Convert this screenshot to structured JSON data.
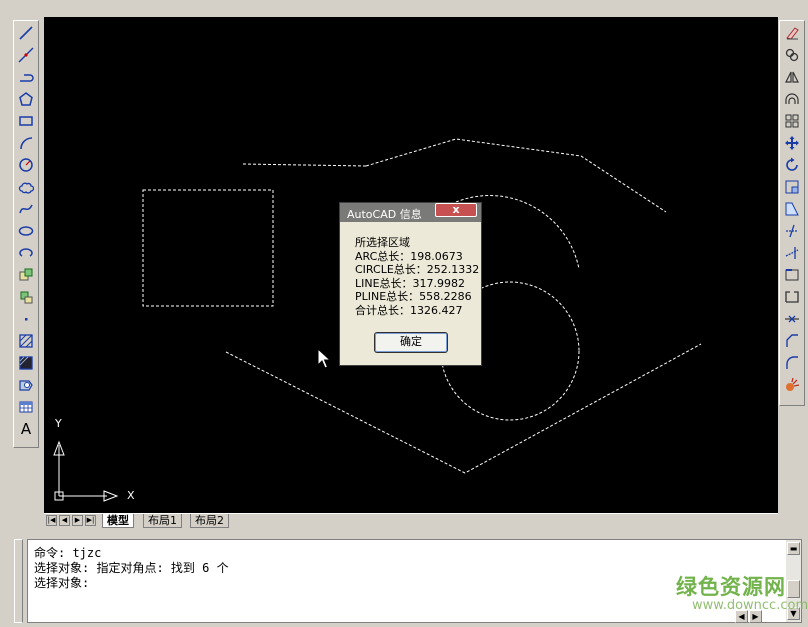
{
  "ucs": {
    "y_label": "Y",
    "x_label": "X"
  },
  "layout_tabs": {
    "tabs": [
      "模型",
      "布局1",
      "布局2"
    ],
    "active": "模型"
  },
  "command_window": {
    "lines": [
      "命令: tjzc",
      "选择对象: 指定对角点: 找到 6 个",
      "选择对象:"
    ]
  },
  "dialog": {
    "title": "AutoCAD 信息",
    "close_label": "x",
    "lines": [
      "所选择区域",
      "ARC总长：198.0673",
      "CIRCLE总长：252.1332",
      "LINE总长：317.9982",
      "PLINE总长：558.2286",
      "合计总长：1326.427"
    ],
    "ok_label": "确定"
  },
  "watermark": {
    "text": "绿色资源网",
    "url": "www.downcc.com"
  },
  "left_toolbar": [
    "line-icon",
    "construction-line-icon",
    "polyline-icon",
    "polygon-icon",
    "rectangle-icon",
    "arc-icon",
    "circle-icon",
    "revision-cloud-icon",
    "spline-icon",
    "ellipse-icon",
    "ellipse-arc-icon",
    "insert-block-icon",
    "make-block-icon",
    "point-icon",
    "hatch-icon",
    "gradient-icon",
    "region-icon",
    "table-icon",
    "multiline-text-icon"
  ],
  "right_toolbar": [
    "erase-icon",
    "copy-icon",
    "mirror-icon",
    "offset-icon",
    "array-icon",
    "move-icon",
    "rotate-icon",
    "scale-icon",
    "stretch-icon",
    "trim-icon",
    "extend-icon",
    "break-at-point-icon",
    "break-icon",
    "join-icon",
    "chamfer-icon",
    "fillet-icon",
    "explode-icon"
  ],
  "colors": {
    "canvas": "#000000",
    "chrome": "#d4d0c8",
    "selection": "#ffffff",
    "watermark": "#5aa62c"
  }
}
